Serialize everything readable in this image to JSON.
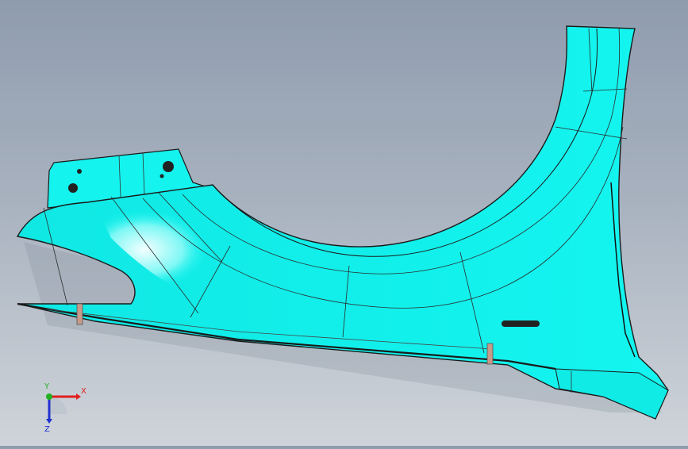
{
  "viewport": {
    "background_top": "#8f9cae",
    "background_bottom": "#cfd4da",
    "part_color": "#13f3ee",
    "part_highlight": "#e8ffff",
    "edge_color": "#1a1a1a"
  },
  "triad": {
    "x_label": "X",
    "y_label": "Y",
    "z_label": "Z",
    "x_color": "#e0201f",
    "y_color": "#20b020",
    "z_color": "#2030d0"
  }
}
